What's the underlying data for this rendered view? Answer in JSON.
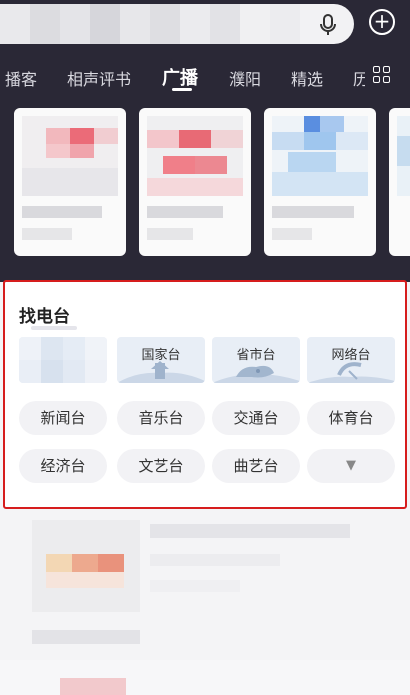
{
  "search": {
    "mic_icon": "microphone-icon",
    "add_icon": "plus-circle-icon"
  },
  "tabs": [
    {
      "label": "播客",
      "active": false
    },
    {
      "label": "相声评书",
      "active": false
    },
    {
      "label": "广播",
      "active": true
    },
    {
      "label": "濮阳",
      "active": false
    },
    {
      "label": "精选",
      "active": false
    },
    {
      "label": "历",
      "active": false
    }
  ],
  "more_tabs_icon": "grid-icon",
  "find_radio": {
    "title": "找电台",
    "categories": [
      "国家台",
      "省市台",
      "网络台"
    ],
    "types": [
      "新闻台",
      "音乐台",
      "交通台",
      "体育台",
      "经济台",
      "文艺台",
      "曲艺台"
    ],
    "expand_icon": "▼"
  },
  "colors": {
    "header_bg": "#2a2836",
    "highlight_border": "#d61d1d",
    "pill_bg": "#f2f2f5"
  }
}
